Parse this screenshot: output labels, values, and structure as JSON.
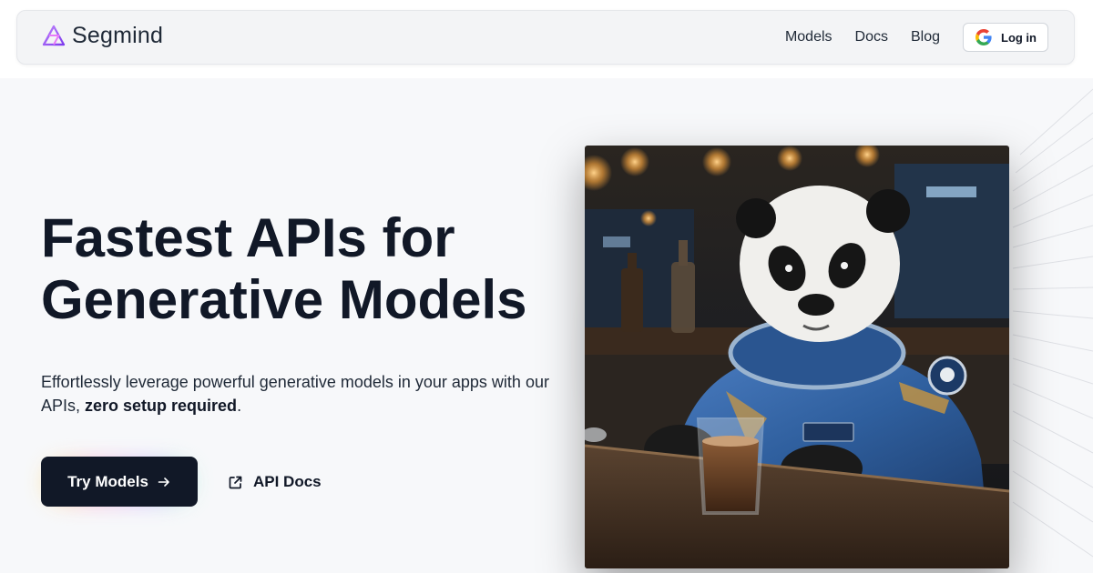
{
  "brand": {
    "name": "Segmind",
    "logo_icon": "segmind-triangle-icon",
    "accent": "#a855f7"
  },
  "nav": {
    "links": [
      "Models",
      "Docs",
      "Blog"
    ],
    "login_label": "Log in",
    "login_icon": "google-g-icon"
  },
  "hero": {
    "title_line1": "Fastest APIs for",
    "title_line2": "Generative Models",
    "subtitle_prefix": "Effortlessly leverage powerful generative models in your apps with our APIs, ",
    "subtitle_bold": "zero setup required",
    "subtitle_suffix": ".",
    "primary_button": "Try Models",
    "primary_icon": "arrow-right-icon",
    "secondary_button": "API Docs",
    "secondary_icon": "external-link-icon",
    "image_subject": "panda-astronaut-at-bar-image"
  },
  "colors": {
    "background": "#f7f8fa",
    "text": "#111827",
    "button_dark": "#111827",
    "suit_blue": "#2f5f9e"
  }
}
